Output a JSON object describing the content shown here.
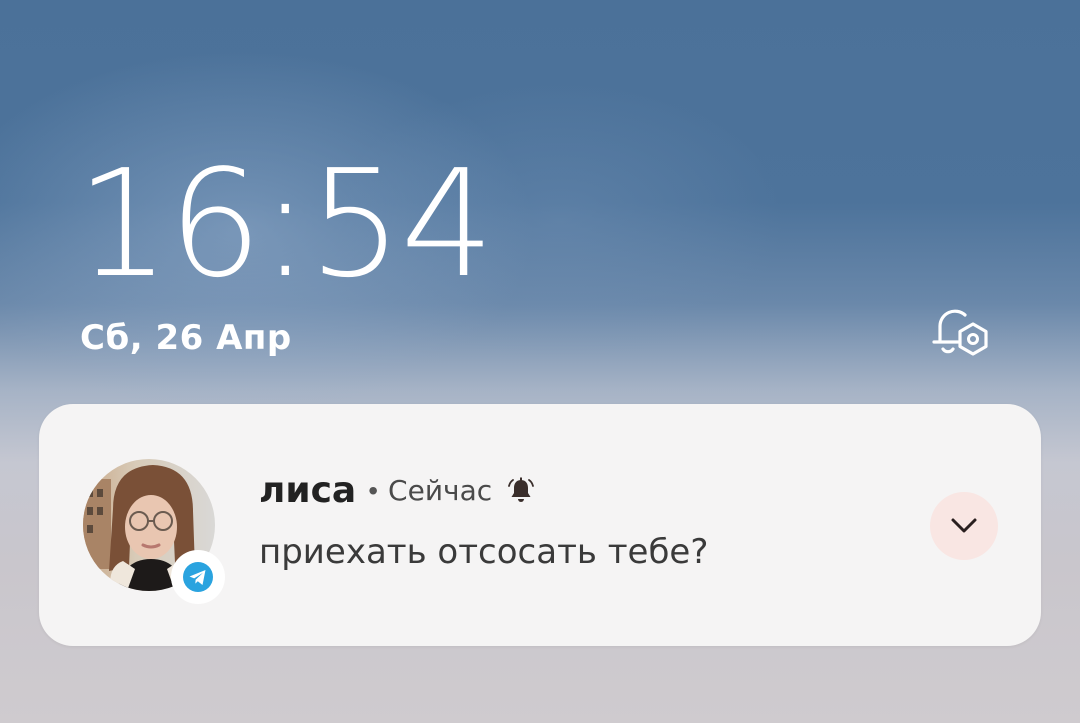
{
  "lockscreen": {
    "time": "16:54",
    "date": "Сб, 26 Апр"
  },
  "notification": {
    "app_icon": "telegram-icon",
    "sender": "лиса",
    "separator": "•",
    "time": "Сейчас",
    "message": "приехать отсосать тебе?",
    "bell_icon": "bell-icon",
    "expand_icon": "chevron-down-icon"
  },
  "icons": {
    "notification_settings": "bell-gear-icon"
  },
  "colors": {
    "accent_telegram": "#2aa3df",
    "expand_bg": "#f9e6e3"
  }
}
